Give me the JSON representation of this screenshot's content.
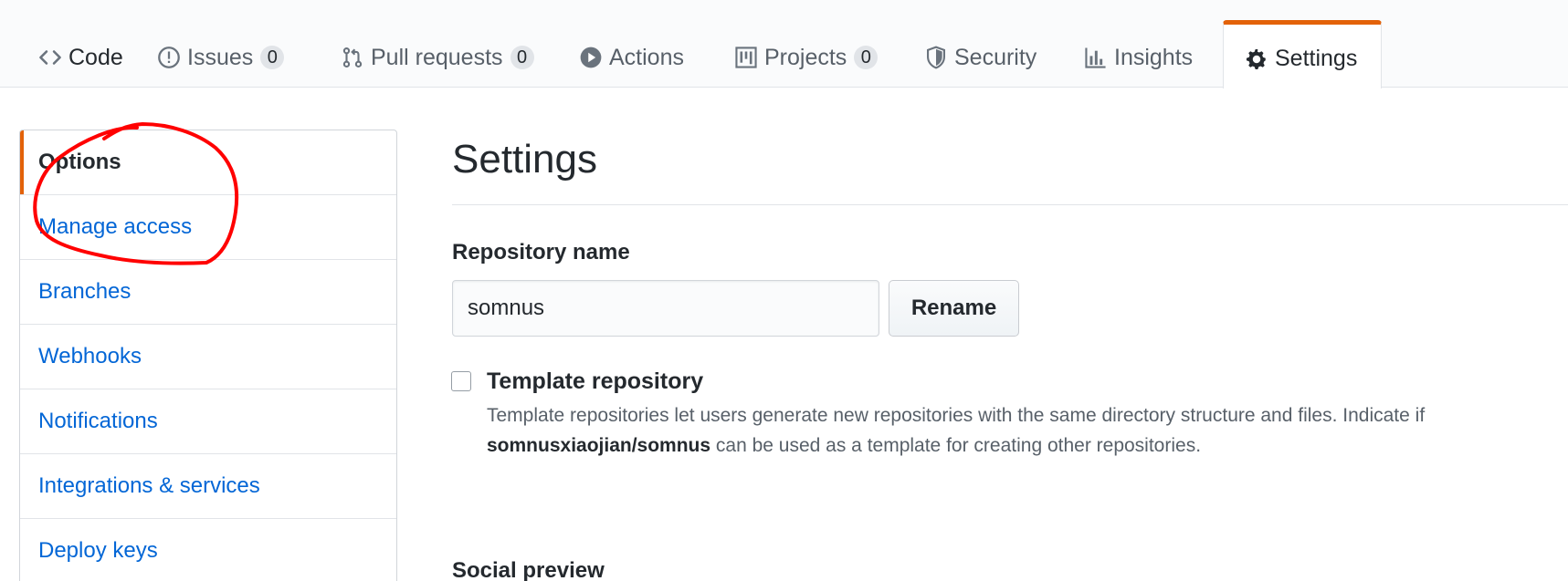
{
  "tabs": [
    {
      "label": "Code",
      "icon": "code-icon",
      "count": null
    },
    {
      "label": "Issues",
      "icon": "issue-opened-icon",
      "count": "0"
    },
    {
      "label": "Pull requests",
      "icon": "git-pull-request-icon",
      "count": "0"
    },
    {
      "label": "Actions",
      "icon": "play-icon",
      "count": null
    },
    {
      "label": "Projects",
      "icon": "project-icon",
      "count": "0"
    },
    {
      "label": "Security",
      "icon": "shield-icon",
      "count": null
    },
    {
      "label": "Insights",
      "icon": "graph-icon",
      "count": null
    },
    {
      "label": "Settings",
      "icon": "gear-icon",
      "count": null,
      "selected": true
    }
  ],
  "menu": {
    "items": [
      {
        "label": "Options",
        "selected": true
      },
      {
        "label": "Manage access"
      },
      {
        "label": "Branches"
      },
      {
        "label": "Webhooks"
      },
      {
        "label": "Notifications"
      },
      {
        "label": "Integrations & services"
      },
      {
        "label": "Deploy keys"
      }
    ]
  },
  "main": {
    "title": "Settings",
    "repo_name_label": "Repository name",
    "repo_name_value": "somnus",
    "rename_label": "Rename",
    "template": {
      "label": "Template repository",
      "checked": false,
      "desc_part1": "Template repositories let users generate new repositories with the same directory structure and files. Indicate if",
      "repo_full_name": "somnusxiaojian/somnus",
      "desc_part2": "can be used as a template for creating other repositories."
    },
    "social_preview_label": "Social preview"
  },
  "colors": {
    "accent_tab": "#e36209",
    "link": "#0366d6",
    "annotation": "#ff0000"
  }
}
